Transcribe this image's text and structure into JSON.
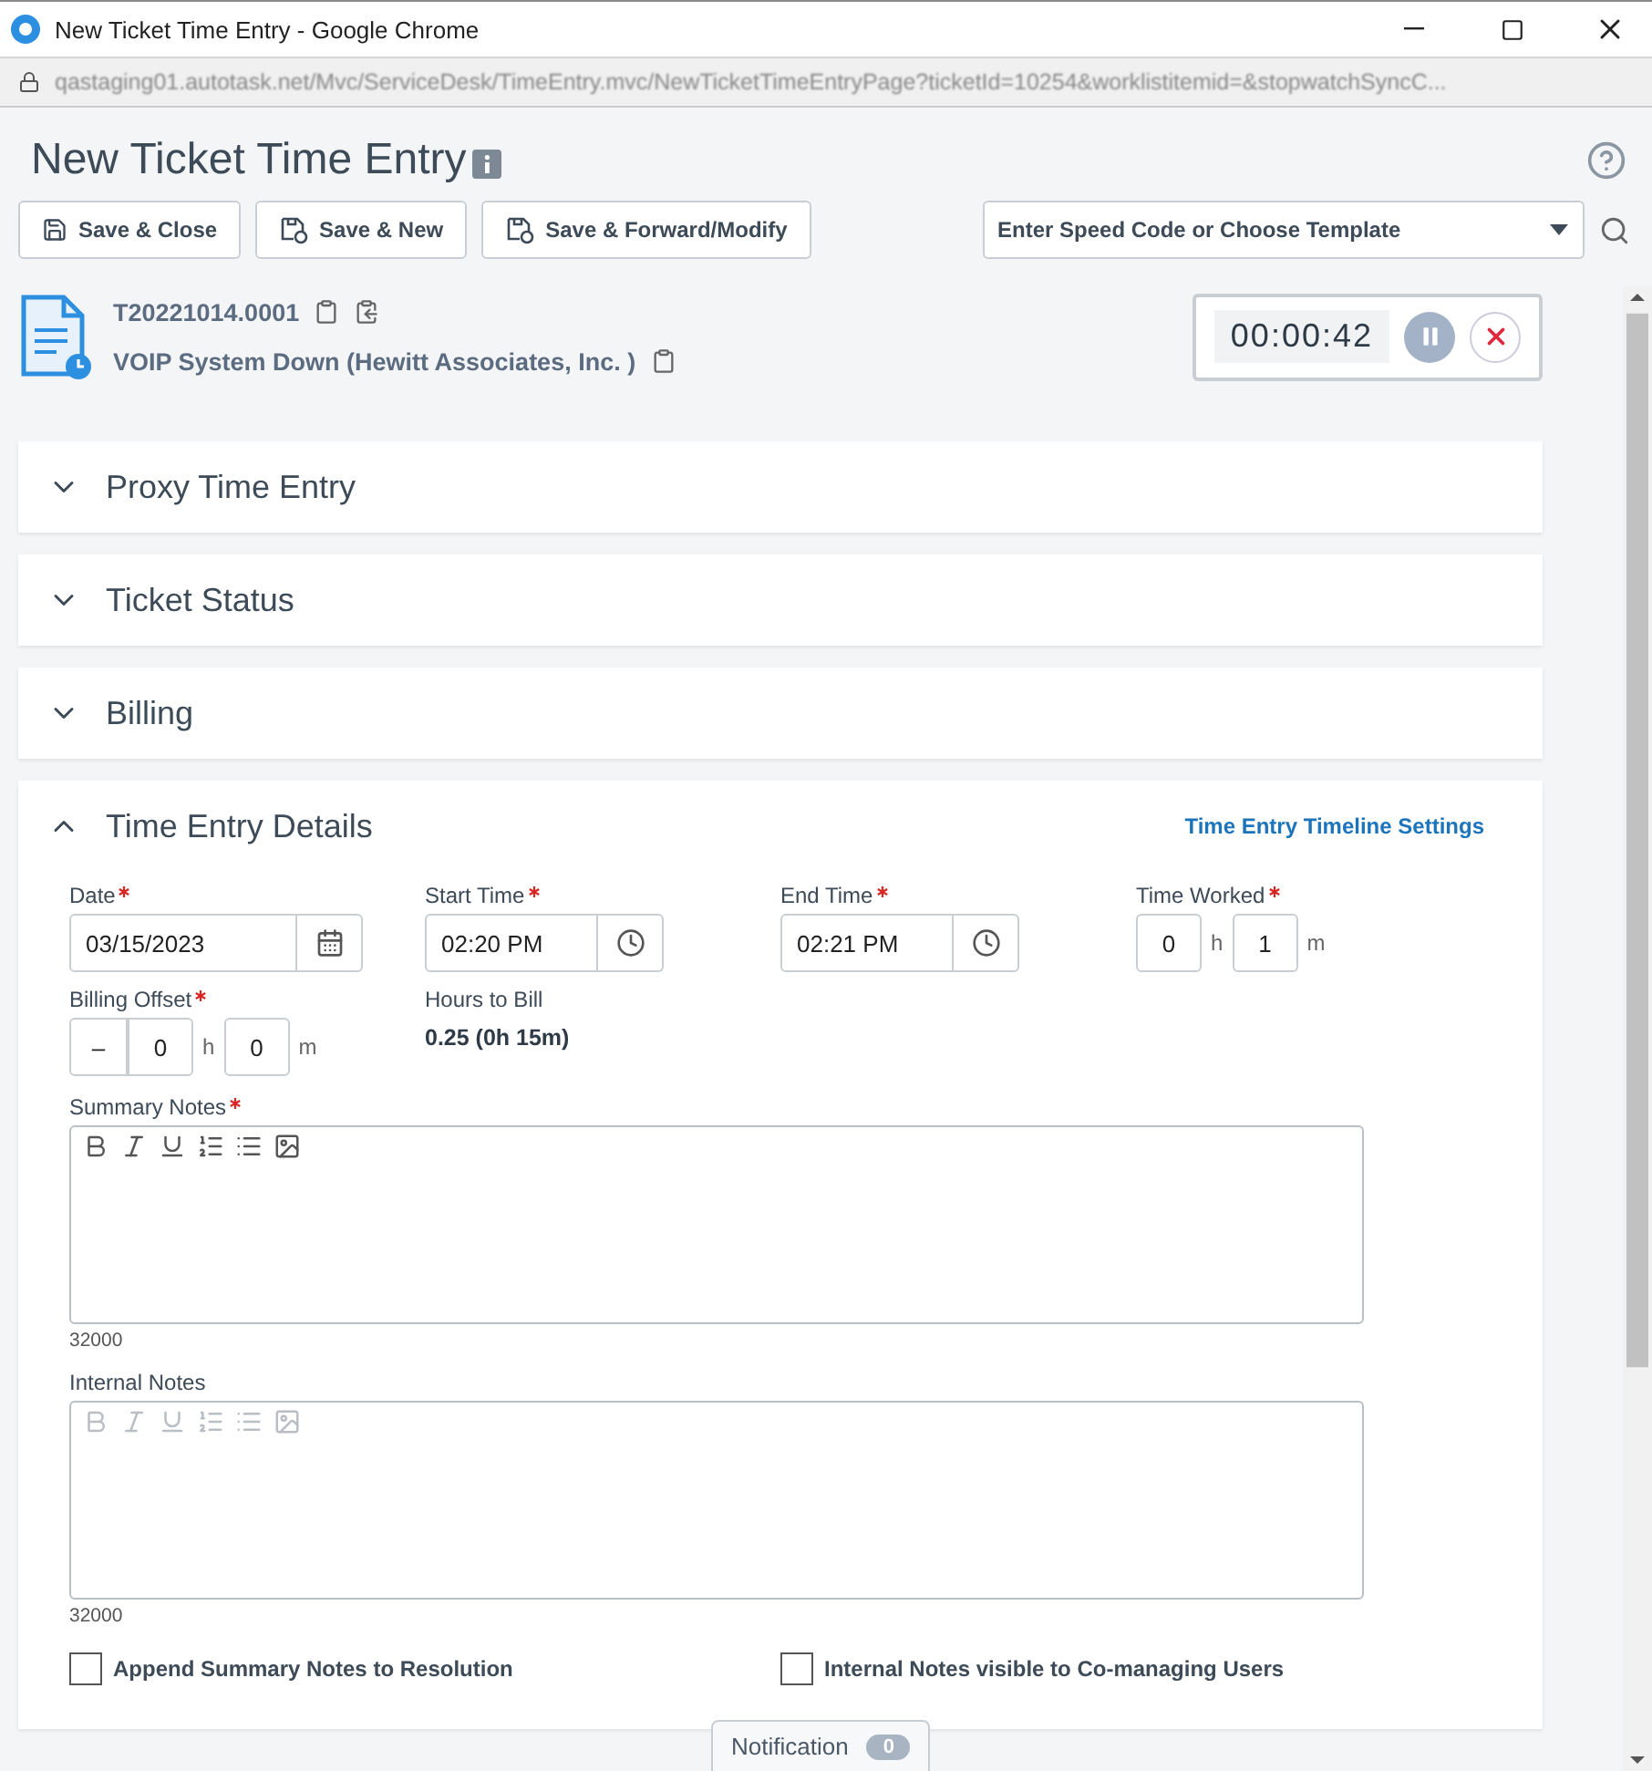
{
  "window": {
    "title": "New Ticket Time Entry - Google Chrome",
    "url": "qastaging01.autotask.net/Mvc/ServiceDesk/TimeEntry.mvc/NewTicketTimeEntryPage?ticketId=10254&worklistitemid=&stopwatchSyncC..."
  },
  "page": {
    "title": "New Ticket Time Entry"
  },
  "toolbar": {
    "buttons": [
      {
        "label": "Save & Close",
        "kind": "save"
      },
      {
        "label": "Save & New",
        "kind": "save-plus"
      },
      {
        "label": "Save & Forward/Modify",
        "kind": "save-plus"
      }
    ],
    "template_select": {
      "placeholder": "Enter Speed Code or Choose Template"
    }
  },
  "ticket": {
    "number": "T20221014.0001",
    "title": "VOIP System Down (Hewitt Associates, Inc. )"
  },
  "timer": {
    "time": "00:00:42",
    "running": true
  },
  "sections": [
    {
      "title": "Proxy Time Entry",
      "expanded": false
    },
    {
      "title": "Ticket Status",
      "expanded": false
    },
    {
      "title": "Billing",
      "expanded": false
    },
    {
      "title": "Time Entry Details",
      "expanded": true,
      "link": "Time Entry Timeline Settings"
    }
  ],
  "details": {
    "fields": [
      {
        "kind": "date",
        "label": "Date",
        "required": true,
        "value": "03/15/2023"
      },
      {
        "kind": "time",
        "label": "Start Time",
        "required": true,
        "value": "02:20 PM"
      },
      {
        "kind": "time",
        "label": "End Time",
        "required": true,
        "value": "02:21 PM"
      },
      {
        "kind": "duration",
        "label": "Time Worked",
        "required": true,
        "hours": "0",
        "hours_unit": "h",
        "minutes": "1",
        "minutes_unit": "m"
      },
      {
        "kind": "offset",
        "label": "Billing Offset",
        "required": true,
        "sign": "–",
        "hours": "0",
        "hours_unit": "h",
        "minutes": "0",
        "minutes_unit": "m"
      },
      {
        "kind": "readonly",
        "label": "Hours to Bill",
        "required": false,
        "value": "0.25 (0h 15m)"
      }
    ],
    "notes": [
      {
        "label": "Summary Notes",
        "required": true,
        "disabled": false,
        "counter": "32000"
      },
      {
        "label": "Internal Notes",
        "required": false,
        "disabled": true,
        "counter": "32000"
      }
    ],
    "checkboxes": [
      {
        "label": "Append Summary Notes to Resolution",
        "checked": false
      },
      {
        "label": "Internal Notes visible to Co-managing Users",
        "checked": false
      }
    ]
  },
  "notification": {
    "label": "Notification",
    "count": "0"
  }
}
